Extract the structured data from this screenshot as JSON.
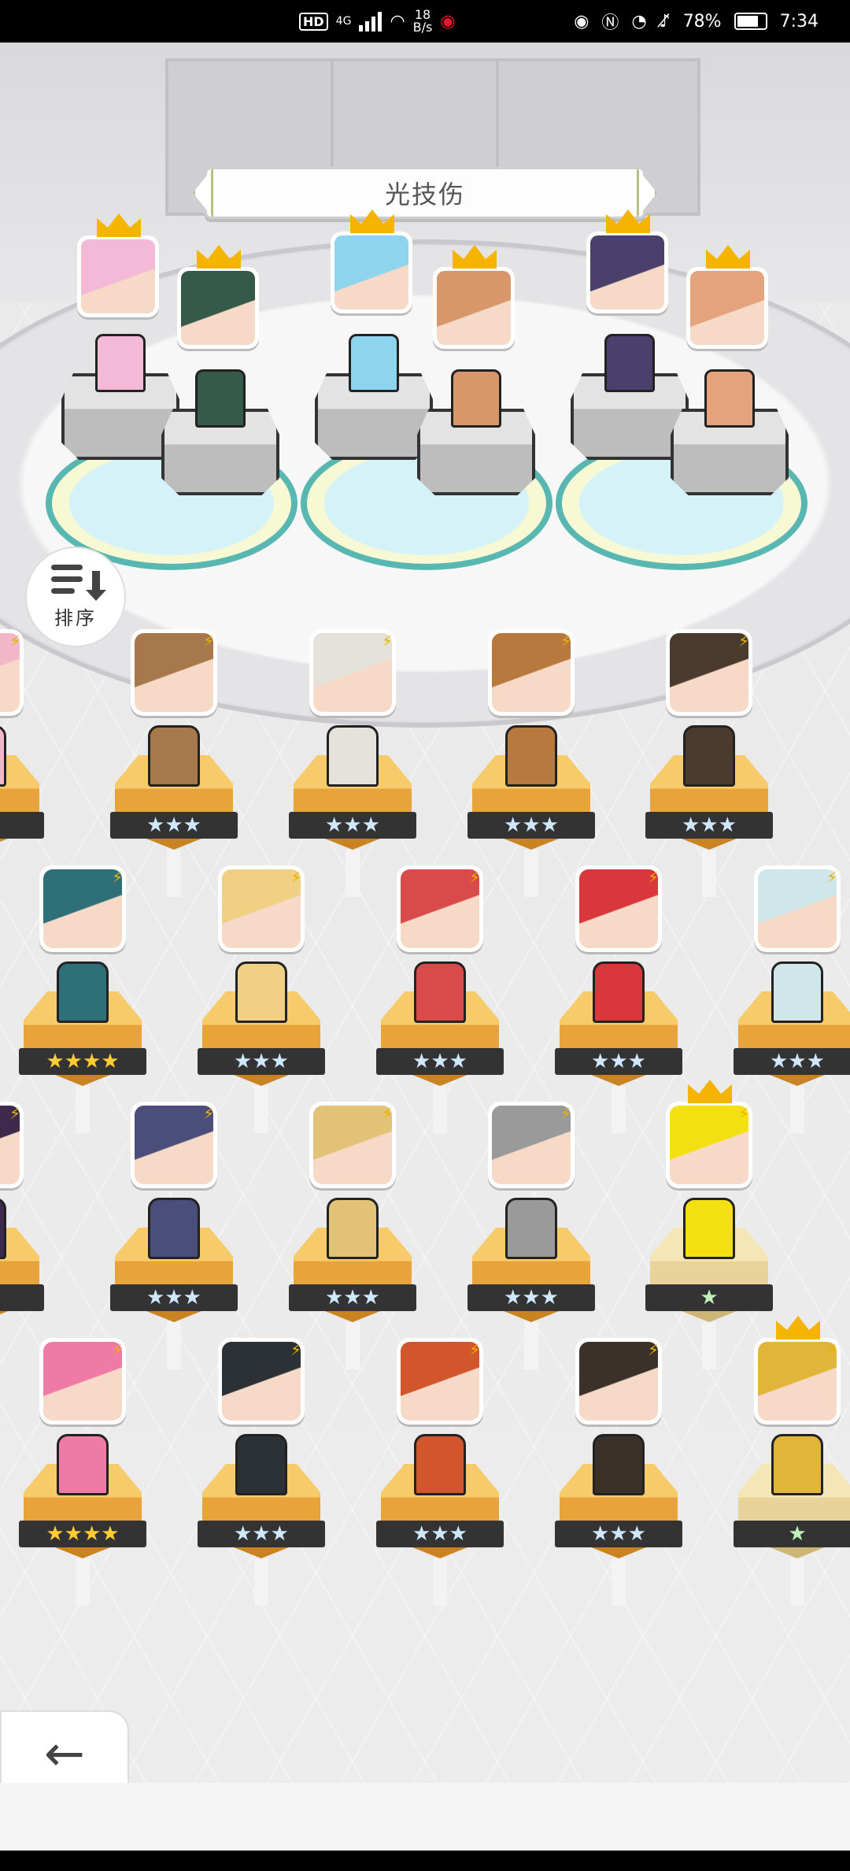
{
  "status_bar": {
    "hd": "HD",
    "network_tag": "4G",
    "speed_value": "18",
    "speed_unit": "B/s",
    "battery": "78%",
    "time": "7:34"
  },
  "header": {
    "title": "光技伤"
  },
  "sort_button": {
    "label": "排序"
  },
  "back_button": {
    "label": "返回"
  },
  "team": [
    {
      "face": "#f3b9d6"
    },
    {
      "face": "#355a4a"
    },
    {
      "face": "#8fd4ee"
    },
    {
      "face": "#d7976a"
    },
    {
      "face": "#4b3f6b"
    },
    {
      "face": "#e4a27d"
    }
  ],
  "heroes": [
    {
      "stars": "★★",
      "star_color": "gold",
      "face": "#f2b6c8"
    },
    {
      "stars": "★★★",
      "star_color": "blue",
      "face": "#a7784c"
    },
    {
      "stars": "★★★",
      "star_color": "blue",
      "face": "#e5e2dc"
    },
    {
      "stars": "★★★",
      "star_color": "blue",
      "face": "#b8793f"
    },
    {
      "stars": "★★★",
      "star_color": "blue",
      "face": "#4b3b2f"
    },
    {
      "stars": "★★★★",
      "star_color": "gold",
      "face": "#2f6f78"
    },
    {
      "stars": "★★★",
      "star_color": "blue",
      "face": "#f0d083"
    },
    {
      "stars": "★★★",
      "star_color": "blue",
      "face": "#d94a4a"
    },
    {
      "stars": "★★★",
      "star_color": "blue",
      "face": "#d8383b"
    },
    {
      "stars": "★★★",
      "star_color": "blue",
      "face": "#cfe6ea"
    },
    {
      "stars": "★★",
      "star_color": "gold",
      "face": "#3d2a4c"
    },
    {
      "stars": "★★★",
      "star_color": "blue",
      "face": "#4b4e7a"
    },
    {
      "stars": "★★★",
      "star_color": "blue",
      "face": "#e2c277"
    },
    {
      "stars": "★★★",
      "star_color": "blue",
      "face": "#9a9a9a"
    },
    {
      "stars": "★",
      "star_color": "green",
      "face": "#f4e012"
    },
    {
      "stars": "★★★★",
      "star_color": "gold",
      "face": "#f07aa6"
    },
    {
      "stars": "★★★",
      "star_color": "blue",
      "face": "#2c3136"
    },
    {
      "stars": "★★★",
      "star_color": "blue",
      "face": "#d2562b"
    },
    {
      "stars": "★★★",
      "star_color": "blue",
      "face": "#3b312b"
    },
    {
      "stars": "★",
      "star_color": "green",
      "face": "#e1b43a"
    }
  ]
}
